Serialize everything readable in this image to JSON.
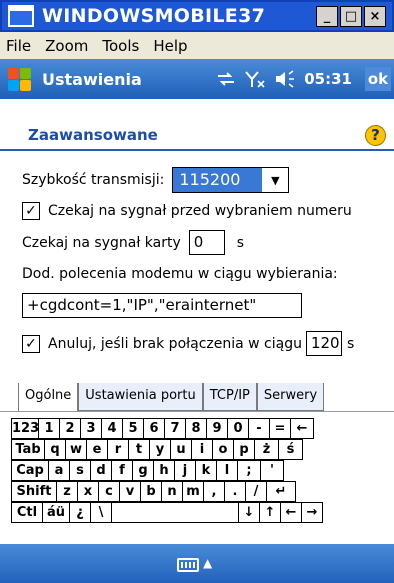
{
  "window": {
    "title": "WINDOWSMOBILE37",
    "controls": [
      "_",
      "□",
      "×"
    ]
  },
  "menubar": {
    "items": [
      "File",
      "Zoom",
      "Tools",
      "Help"
    ]
  },
  "navbar": {
    "title": "Ustawienia",
    "time": "05:31",
    "ok_label": "ok",
    "status_icons": [
      "connectivity-icon",
      "signal-off-icon",
      "volume-icon"
    ]
  },
  "page": {
    "title": "Zaawansowane",
    "help_icon": "?"
  },
  "form": {
    "baud_label": "Szybkość transmisji:",
    "baud_value": "115200",
    "wait_dial_tone_label": "Czekaj na sygnał przed wybraniem numeru",
    "wait_dial_tone_checked": true,
    "wait_card_label": "Czekaj na sygnał karty",
    "wait_card_value": "0",
    "wait_card_unit": "s",
    "extra_cmds_label": "Dod. polecenia modemu w ciągu wybierania:",
    "extra_cmds_value": "+cgdcont=1,\"IP\",\"erainternet\"",
    "cancel_label": "Anuluj, jeśli brak połączenia w ciągu",
    "cancel_checked": true,
    "cancel_value": "120",
    "cancel_unit": "s"
  },
  "tabs": [
    {
      "label": "Ogólne",
      "active": true
    },
    {
      "label": "Ustawienia portu",
      "active": false
    },
    {
      "label": "TCP/IP",
      "active": false
    },
    {
      "label": "Serwery",
      "active": false
    }
  ],
  "keyboard": {
    "rows": [
      [
        "123",
        "1",
        "2",
        "3",
        "4",
        "5",
        "6",
        "7",
        "8",
        "9",
        "0",
        "-",
        "=",
        "←"
      ],
      [
        "Tab",
        "q",
        "w",
        "e",
        "r",
        "t",
        "y",
        "u",
        "i",
        "o",
        "p",
        "ż",
        "ś"
      ],
      [
        "Cap",
        "a",
        "s",
        "d",
        "f",
        "g",
        "h",
        "j",
        "k",
        "l",
        ";",
        "'"
      ],
      [
        "Shift",
        "z",
        "x",
        "c",
        "v",
        "b",
        "n",
        "m",
        ",",
        ".",
        "/",
        "↵"
      ],
      [
        "Ctl",
        "áü",
        "¿",
        "\\",
        " ",
        "↓",
        "↑",
        "←",
        "→"
      ]
    ]
  },
  "sipbar": {
    "arrow": "▲"
  }
}
